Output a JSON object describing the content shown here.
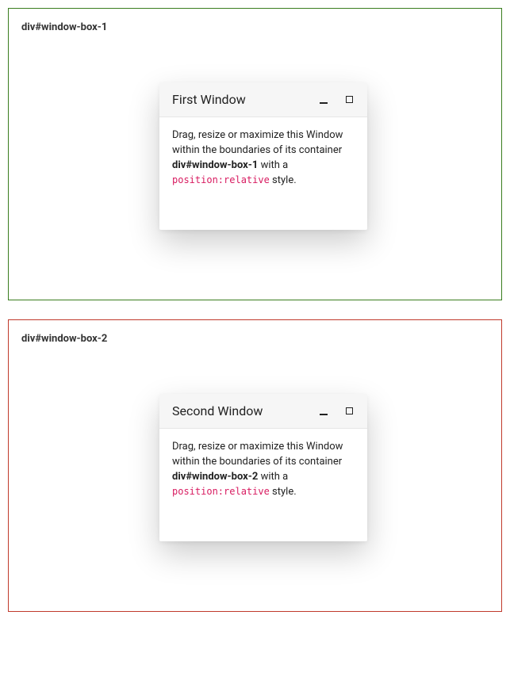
{
  "boxes": [
    {
      "label": "div#window-box-1",
      "window": {
        "title": "First Window",
        "body_prefix": "Drag, resize or maximize this Window within the boundaries of its container ",
        "container_name": "div#window-box-1",
        "body_mid": " with a ",
        "code_text": "position:relative",
        "body_suffix": " style."
      }
    },
    {
      "label": "div#window-box-2",
      "window": {
        "title": "Second Window",
        "body_prefix": "Drag, resize or maximize this Window within the boundaries of its container ",
        "container_name": "div#window-box-2",
        "body_mid": " with a ",
        "code_text": "position:relative",
        "body_suffix": " style."
      }
    }
  ]
}
